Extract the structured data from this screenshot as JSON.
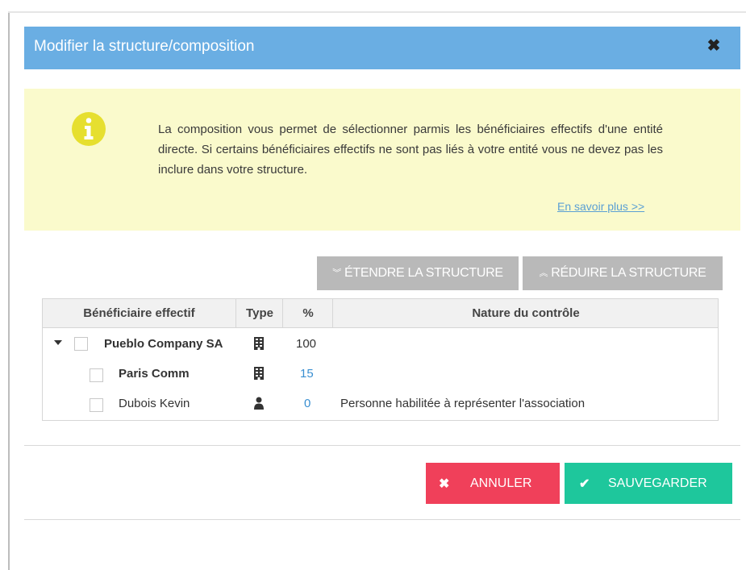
{
  "modal": {
    "title": "Modifier la structure/composition",
    "close_icon": "close-icon"
  },
  "info": {
    "icon": "info-icon",
    "text": "La composition vous permet de sélectionner parmis les bénéficiaires effectifs d'une entité directe. Si certains bénéficiaires effectifs ne sont pas liés à votre entité vous ne devez pas les inclure dans votre structure.",
    "link": "En savoir plus >>"
  },
  "toolbar": {
    "expand_label": "ÉTENDRE LA STRUCTURE",
    "collapse_label": "RÉDUIRE LA STRUCTURE"
  },
  "table": {
    "headers": [
      "Bénéficiaire effectif",
      "Type",
      "%",
      "Nature du contrôle"
    ],
    "rows": [
      {
        "name": "Pueblo Company SA",
        "type": "building-icon",
        "percent": "100",
        "nature": ""
      },
      {
        "name": "Paris Comm",
        "type": "building-icon",
        "percent": "15",
        "nature": ""
      },
      {
        "name": "Dubois Kevin",
        "type": "person-icon",
        "percent": "0",
        "nature": "Personne habilitée à représenter l'association"
      }
    ]
  },
  "footer": {
    "cancel_label": "ANNULER",
    "save_label": "SAUVEGARDER"
  },
  "colors": {
    "header": "#6aaee3",
    "info_bg": "#fafacc",
    "cancel": "#f0405a",
    "save": "#1ec79c",
    "secondary_button": "#b9b9b9"
  }
}
